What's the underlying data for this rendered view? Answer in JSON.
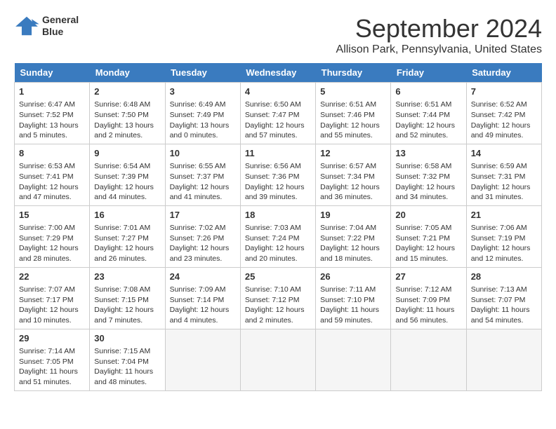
{
  "header": {
    "logo_line1": "General",
    "logo_line2": "Blue",
    "month_title": "September 2024",
    "location": "Allison Park, Pennsylvania, United States"
  },
  "calendar": {
    "days_of_week": [
      "Sunday",
      "Monday",
      "Tuesday",
      "Wednesday",
      "Thursday",
      "Friday",
      "Saturday"
    ],
    "weeks": [
      [
        {
          "day": "1",
          "info": "Sunrise: 6:47 AM\nSunset: 7:52 PM\nDaylight: 13 hours\nand 5 minutes."
        },
        {
          "day": "2",
          "info": "Sunrise: 6:48 AM\nSunset: 7:50 PM\nDaylight: 13 hours\nand 2 minutes."
        },
        {
          "day": "3",
          "info": "Sunrise: 6:49 AM\nSunset: 7:49 PM\nDaylight: 13 hours\nand 0 minutes."
        },
        {
          "day": "4",
          "info": "Sunrise: 6:50 AM\nSunset: 7:47 PM\nDaylight: 12 hours\nand 57 minutes."
        },
        {
          "day": "5",
          "info": "Sunrise: 6:51 AM\nSunset: 7:46 PM\nDaylight: 12 hours\nand 55 minutes."
        },
        {
          "day": "6",
          "info": "Sunrise: 6:51 AM\nSunset: 7:44 PM\nDaylight: 12 hours\nand 52 minutes."
        },
        {
          "day": "7",
          "info": "Sunrise: 6:52 AM\nSunset: 7:42 PM\nDaylight: 12 hours\nand 49 minutes."
        }
      ],
      [
        {
          "day": "8",
          "info": "Sunrise: 6:53 AM\nSunset: 7:41 PM\nDaylight: 12 hours\nand 47 minutes."
        },
        {
          "day": "9",
          "info": "Sunrise: 6:54 AM\nSunset: 7:39 PM\nDaylight: 12 hours\nand 44 minutes."
        },
        {
          "day": "10",
          "info": "Sunrise: 6:55 AM\nSunset: 7:37 PM\nDaylight: 12 hours\nand 41 minutes."
        },
        {
          "day": "11",
          "info": "Sunrise: 6:56 AM\nSunset: 7:36 PM\nDaylight: 12 hours\nand 39 minutes."
        },
        {
          "day": "12",
          "info": "Sunrise: 6:57 AM\nSunset: 7:34 PM\nDaylight: 12 hours\nand 36 minutes."
        },
        {
          "day": "13",
          "info": "Sunrise: 6:58 AM\nSunset: 7:32 PM\nDaylight: 12 hours\nand 34 minutes."
        },
        {
          "day": "14",
          "info": "Sunrise: 6:59 AM\nSunset: 7:31 PM\nDaylight: 12 hours\nand 31 minutes."
        }
      ],
      [
        {
          "day": "15",
          "info": "Sunrise: 7:00 AM\nSunset: 7:29 PM\nDaylight: 12 hours\nand 28 minutes."
        },
        {
          "day": "16",
          "info": "Sunrise: 7:01 AM\nSunset: 7:27 PM\nDaylight: 12 hours\nand 26 minutes."
        },
        {
          "day": "17",
          "info": "Sunrise: 7:02 AM\nSunset: 7:26 PM\nDaylight: 12 hours\nand 23 minutes."
        },
        {
          "day": "18",
          "info": "Sunrise: 7:03 AM\nSunset: 7:24 PM\nDaylight: 12 hours\nand 20 minutes."
        },
        {
          "day": "19",
          "info": "Sunrise: 7:04 AM\nSunset: 7:22 PM\nDaylight: 12 hours\nand 18 minutes."
        },
        {
          "day": "20",
          "info": "Sunrise: 7:05 AM\nSunset: 7:21 PM\nDaylight: 12 hours\nand 15 minutes."
        },
        {
          "day": "21",
          "info": "Sunrise: 7:06 AM\nSunset: 7:19 PM\nDaylight: 12 hours\nand 12 minutes."
        }
      ],
      [
        {
          "day": "22",
          "info": "Sunrise: 7:07 AM\nSunset: 7:17 PM\nDaylight: 12 hours\nand 10 minutes."
        },
        {
          "day": "23",
          "info": "Sunrise: 7:08 AM\nSunset: 7:15 PM\nDaylight: 12 hours\nand 7 minutes."
        },
        {
          "day": "24",
          "info": "Sunrise: 7:09 AM\nSunset: 7:14 PM\nDaylight: 12 hours\nand 4 minutes."
        },
        {
          "day": "25",
          "info": "Sunrise: 7:10 AM\nSunset: 7:12 PM\nDaylight: 12 hours\nand 2 minutes."
        },
        {
          "day": "26",
          "info": "Sunrise: 7:11 AM\nSunset: 7:10 PM\nDaylight: 11 hours\nand 59 minutes."
        },
        {
          "day": "27",
          "info": "Sunrise: 7:12 AM\nSunset: 7:09 PM\nDaylight: 11 hours\nand 56 minutes."
        },
        {
          "day": "28",
          "info": "Sunrise: 7:13 AM\nSunset: 7:07 PM\nDaylight: 11 hours\nand 54 minutes."
        }
      ],
      [
        {
          "day": "29",
          "info": "Sunrise: 7:14 AM\nSunset: 7:05 PM\nDaylight: 11 hours\nand 51 minutes."
        },
        {
          "day": "30",
          "info": "Sunrise: 7:15 AM\nSunset: 7:04 PM\nDaylight: 11 hours\nand 48 minutes."
        },
        {
          "day": "",
          "info": ""
        },
        {
          "day": "",
          "info": ""
        },
        {
          "day": "",
          "info": ""
        },
        {
          "day": "",
          "info": ""
        },
        {
          "day": "",
          "info": ""
        }
      ]
    ]
  }
}
